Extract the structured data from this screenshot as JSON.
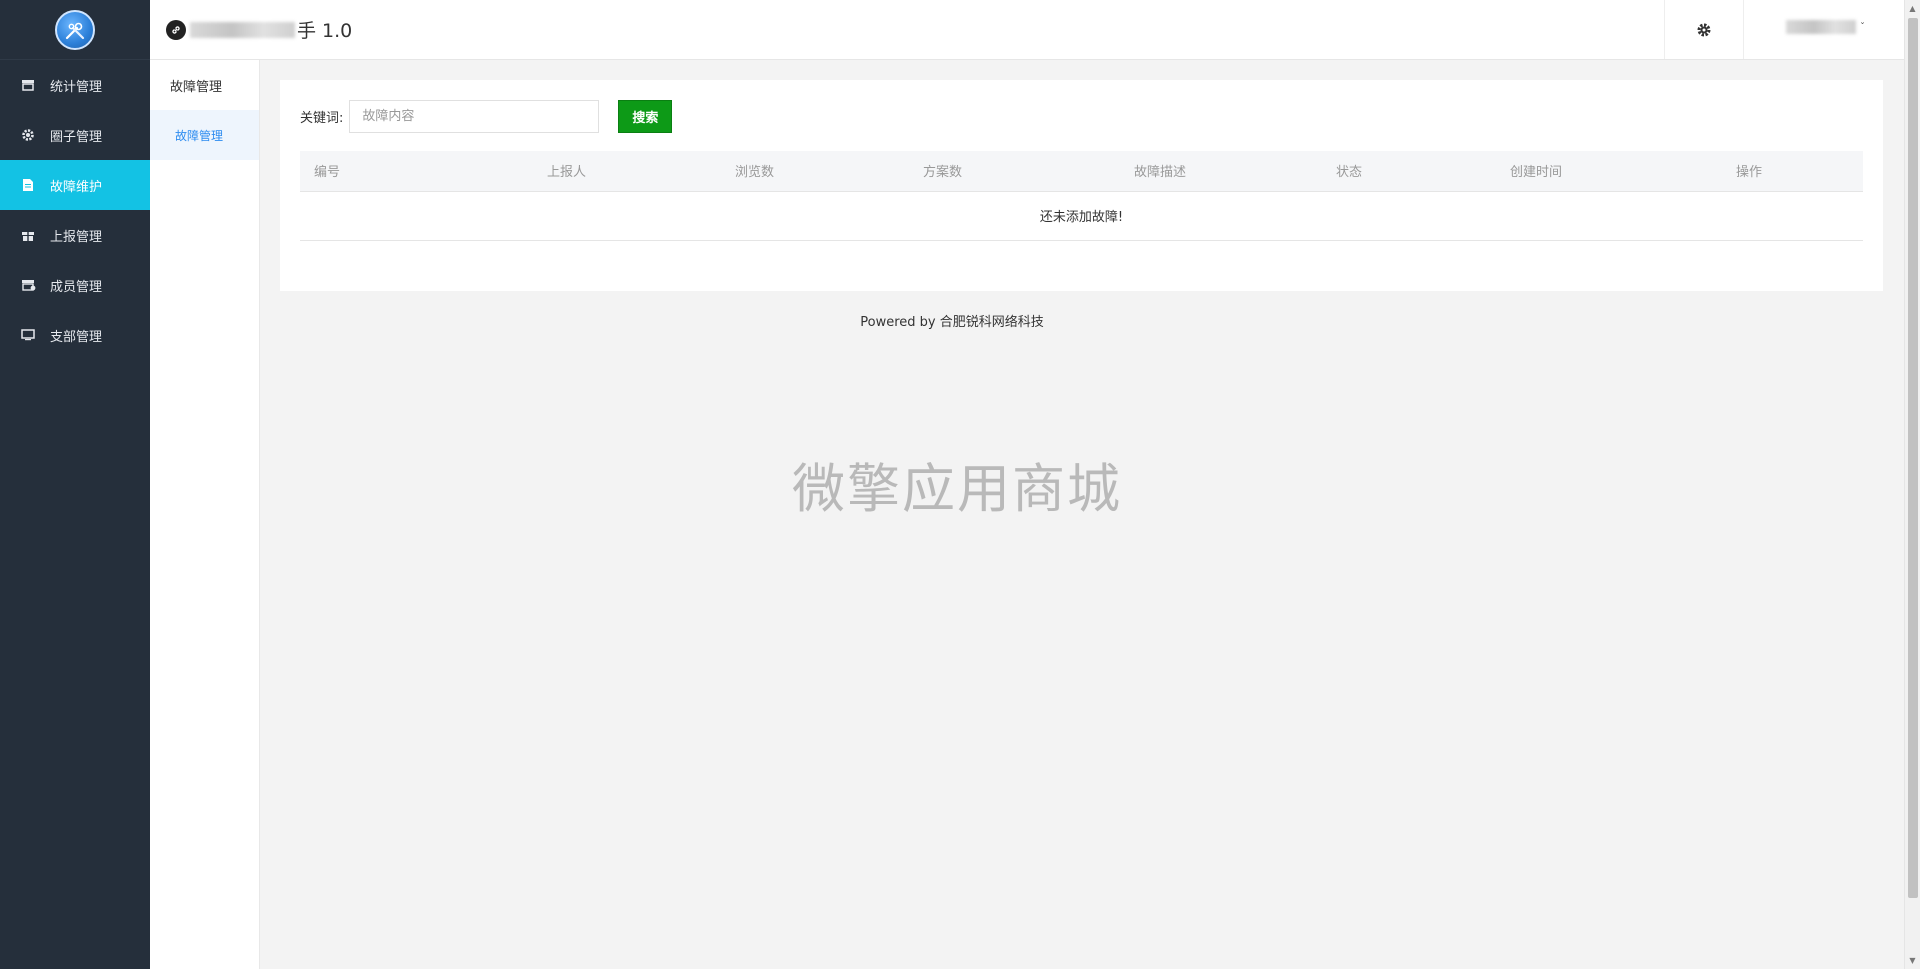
{
  "header": {
    "brand_icon": "link-icon",
    "title": "手 1.0",
    "settings_icon": "gear-icon",
    "user_caret": "ˇ"
  },
  "sidebar": {
    "logo": "app-logo",
    "items": [
      {
        "label": "统计管理",
        "icon": "shop-icon"
      },
      {
        "label": "圈子管理",
        "icon": "gear-icon"
      },
      {
        "label": "故障维护",
        "icon": "document-icon",
        "active": true
      },
      {
        "label": "上报管理",
        "icon": "gift-icon"
      },
      {
        "label": "成员管理",
        "icon": "store-icon"
      },
      {
        "label": "支部管理",
        "icon": "monitor-icon"
      }
    ]
  },
  "subnav": {
    "title": "故障管理",
    "item": "故障管理"
  },
  "search": {
    "label": "关键词:",
    "placeholder": "故障内容",
    "button": "搜索"
  },
  "table": {
    "headers": [
      "编号",
      "上报人",
      "浏览数",
      "方案数",
      "故障描述",
      "状态",
      "创建时间",
      "操作"
    ],
    "empty_text": "还未添加故障!"
  },
  "footer": {
    "prefix": "Powered by",
    "company": "合肥锐科网络科技"
  },
  "watermark": "微擎应用商城",
  "colors": {
    "sidebar_bg": "#252f3b",
    "active_item": "#13c2e4",
    "search_button": "#0d9a17",
    "subnav_active_text": "#2d8cf0"
  }
}
